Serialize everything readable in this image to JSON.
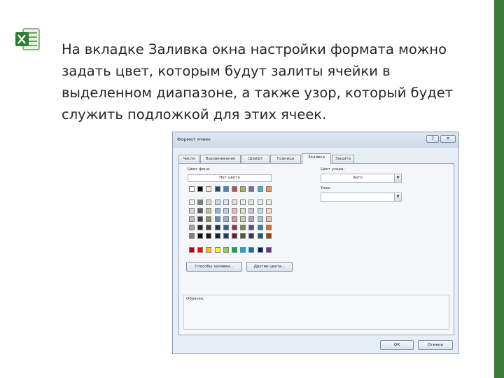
{
  "slide": {
    "lines": [
      "На вкладке Заливка окна настройки формата можно",
      "задать цвет, которым будут залиты ячейки в",
      "выделенном диапазоне, а также узор, который будет",
      "служить подложкой для этих ячеек."
    ],
    "icon": "excel-logo-icon",
    "accent_color": "#3c7a3a"
  },
  "dialog": {
    "title": "Формат ячеек",
    "help": "?",
    "close": "✕",
    "tabs": [
      "Число",
      "Выравнивание",
      "Шрифт",
      "Граница",
      "Заливка",
      "Защита"
    ],
    "active_tab": "Заливка",
    "bg_color_label": "Цвет фона:",
    "no_color": "Нет цвета",
    "pattern_color_label": "Цвет узора:",
    "pattern_color_value": "Авто",
    "pattern_style_label": "Узор:",
    "fill_effects_button": "Способы заливки...",
    "more_colors_button": "Другие цвета...",
    "sample_label": "Образец",
    "ok_button": "ОК",
    "cancel_button": "Отмена",
    "palette": {
      "theme_row": [
        "#ffffff",
        "#000000",
        "#eeece1",
        "#1f497d",
        "#4f81bd",
        "#c0504d",
        "#9bbb59",
        "#8064a2",
        "#4bacc6",
        "#f79646"
      ],
      "tint_rows": [
        [
          "#f2f2f2",
          "#7f7f7f",
          "#ddd9c3",
          "#c6d9f0",
          "#dbe5f1",
          "#f2dcdb",
          "#ebf1dd",
          "#e5e0ec",
          "#dbeef3",
          "#fdeada"
        ],
        [
          "#d8d8d8",
          "#595959",
          "#c4bd97",
          "#8db3e2",
          "#b8cce4",
          "#e5b9b7",
          "#d7e3bc",
          "#ccc1d9",
          "#b7dde8",
          "#fbd5b5"
        ],
        [
          "#bfbfbf",
          "#3f3f3f",
          "#938953",
          "#548dd4",
          "#95b3d7",
          "#d99694",
          "#c3d69b",
          "#b2a2c7",
          "#92cddc",
          "#fac08f"
        ],
        [
          "#a5a5a5",
          "#262626",
          "#494429",
          "#17365d",
          "#366092",
          "#953734",
          "#76923c",
          "#5f497a",
          "#31859b",
          "#e36c09"
        ],
        [
          "#7f7f7f",
          "#0c0c0c",
          "#1d1b10",
          "#0f243e",
          "#244061",
          "#632423",
          "#4f6128",
          "#3f3151",
          "#205867",
          "#974806"
        ]
      ],
      "standard_row": [
        "#c00000",
        "#ff0000",
        "#ffc000",
        "#ffff00",
        "#92d050",
        "#00b050",
        "#00b0f0",
        "#0070c0",
        "#002060",
        "#7030a0"
      ]
    }
  }
}
